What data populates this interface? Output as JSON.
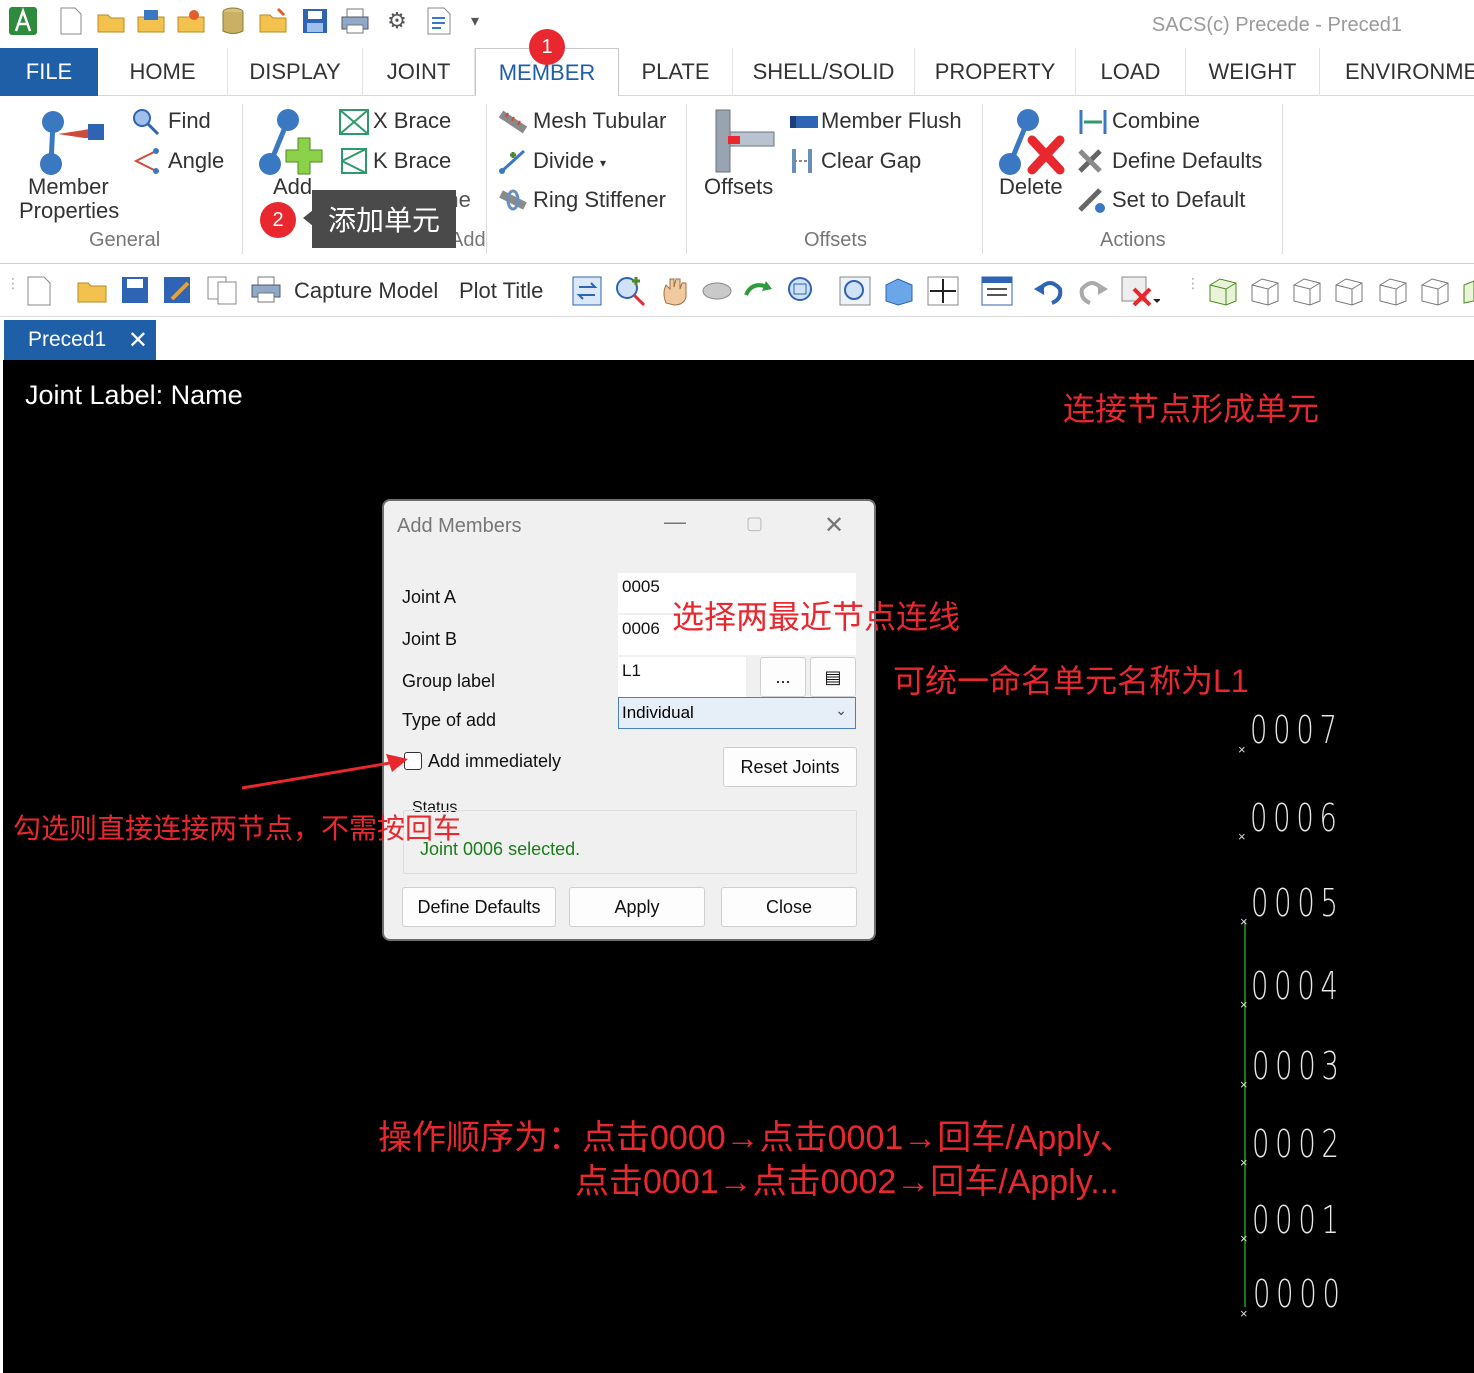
{
  "app_title": "SACS(c) Precede - Preced1",
  "tabs": [
    "FILE",
    "HOME",
    "DISPLAY",
    "JOINT",
    "MEMBER",
    "PLATE",
    "SHELL/SOLID",
    "PROPERTY",
    "LOAD",
    "WEIGHT",
    "ENVIRONME"
  ],
  "step_badges": [
    "1",
    "2"
  ],
  "ribbon": {
    "general": {
      "member_properties_1": "Member",
      "member_properties_2": "Properties",
      "find": "Find",
      "angle": "Angle",
      "label": "General"
    },
    "add": {
      "add": "Add",
      "x_brace": "X Brace",
      "k_brace": "K Brace",
      "wishbone": "Wishbone",
      "label": "Add",
      "tooltip": "添加单元"
    },
    "mesh": {
      "mesh_tubular": "Mesh Tubular",
      "divide": "Divide",
      "ring_stiffener": "Ring Stiffener"
    },
    "offsets": {
      "offsets": "Offsets",
      "member_flush": "Member Flush",
      "clear_gap": "Clear Gap",
      "label": "Offsets"
    },
    "actions": {
      "delete": "Delete",
      "combine": "Combine",
      "define_defaults": "Define Defaults",
      "set_to_default": "Set to Default",
      "label": "Actions"
    }
  },
  "toolbar": {
    "capture_model": "Capture Model",
    "plot_title": "Plot Title"
  },
  "document_tab": {
    "name": "Preced1",
    "close": "✕"
  },
  "viewport": {
    "joint_label": "Joint Label: Name",
    "node_labels": [
      "0007",
      "0006",
      "0005",
      "0004",
      "0003",
      "0002",
      "0001",
      "0000"
    ],
    "annotations": {
      "top": "连接节点形成单元",
      "nearest": "选择两最近节点连线",
      "rename": "可统一命名单元名称为L1",
      "checkbox_note": "勾选则直接连接两节点，不需按回车",
      "sequence_1": "操作顺序为：点击0000→点击0001→回车/Apply、",
      "sequence_2": "点击0001→点击0002→回车/Apply..."
    }
  },
  "dialog": {
    "title": "Add Members",
    "joint_a_label": "Joint A",
    "joint_a_value": "0005",
    "joint_b_label": "Joint B",
    "joint_b_value": "0006",
    "group_label": "Group label",
    "group_value": "L1",
    "browse": "...",
    "type_label": "Type of add",
    "type_value": "Individual",
    "add_immediately": "Add immediately",
    "reset_joints": "Reset Joints",
    "status_label": "Status",
    "status_text": "Joint 0006 selected.",
    "define_defaults": "Define Defaults",
    "apply": "Apply",
    "close": "Close"
  },
  "colors": {
    "accent": "#1f5fa8",
    "annotation": "#e8282e",
    "status_ok": "#1a7d1a",
    "badge": "#e8282e",
    "member_line": "#1fa01f"
  }
}
